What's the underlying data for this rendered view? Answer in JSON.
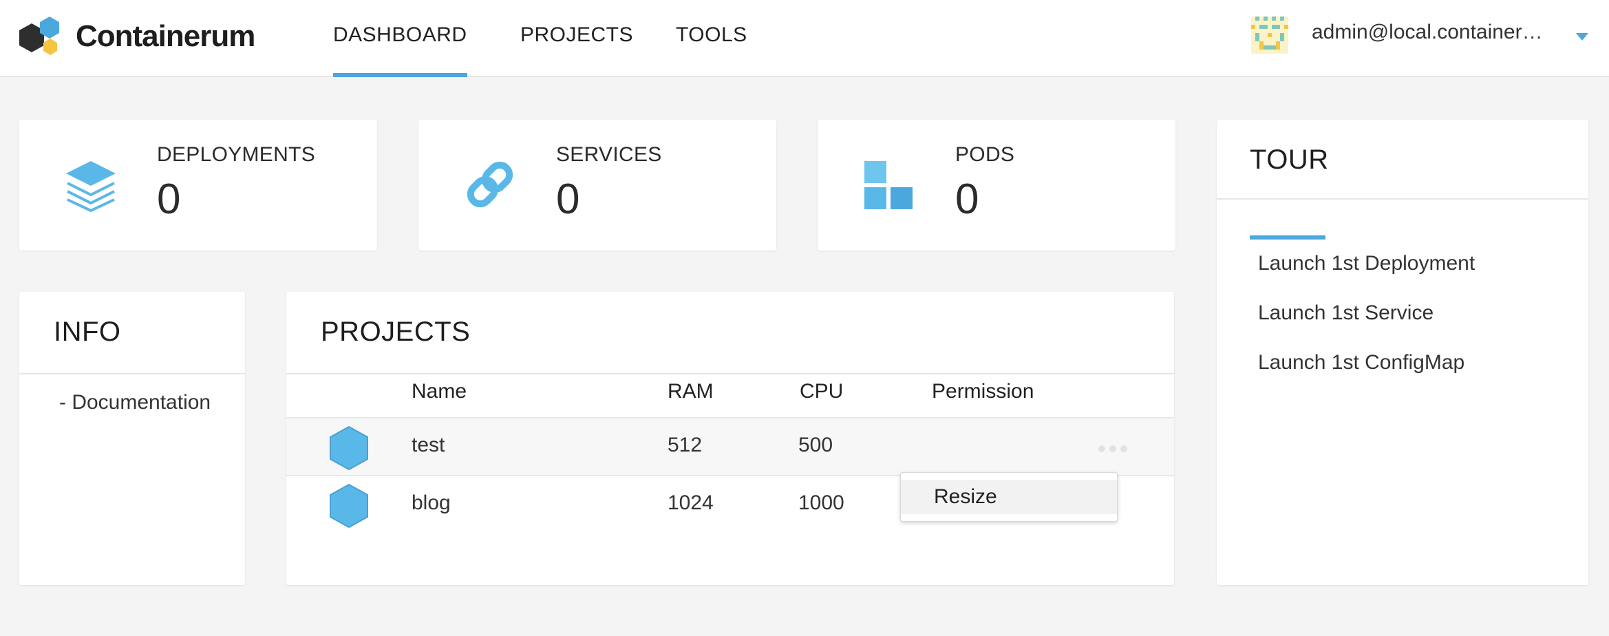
{
  "app": {
    "name": "Containerum",
    "accent_color": "#4aa8de"
  },
  "nav": {
    "items": [
      {
        "label": "DASHBOARD",
        "active": true
      },
      {
        "label": "PROJECTS",
        "active": false
      },
      {
        "label": "TOOLS",
        "active": false
      }
    ]
  },
  "user": {
    "email": "admin@local.containerum.io",
    "avatar": "pixel-avatar",
    "caret": "caret-down-icon"
  },
  "stats": [
    {
      "label": "DEPLOYMENTS",
      "value": "0",
      "icon": "layers-icon"
    },
    {
      "label": "SERVICES",
      "value": "0",
      "icon": "link-icon"
    },
    {
      "label": "PODS",
      "value": "0",
      "icon": "pods-icon"
    }
  ],
  "info": {
    "title": "INFO",
    "links": [
      "- Documentation"
    ]
  },
  "projects": {
    "title": "PROJECTS",
    "columns": [
      "Name",
      "RAM",
      "CPU",
      "Permission"
    ],
    "rows": [
      {
        "name": "test",
        "ram": "512",
        "cpu": "500",
        "permission": ""
      },
      {
        "name": "blog",
        "ram": "1024",
        "cpu": "1000",
        "permission": ""
      }
    ],
    "context_menu": {
      "items": [
        "Resize"
      ]
    }
  },
  "tour": {
    "title": "TOUR",
    "links": [
      "Launch 1st Deployment",
      "Launch 1st Service",
      "Launch 1st ConfigMap"
    ]
  }
}
